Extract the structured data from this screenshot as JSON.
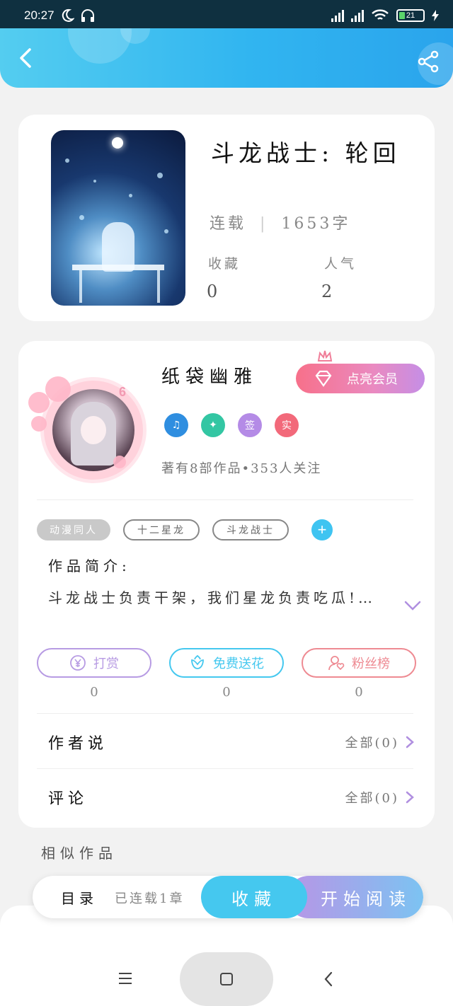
{
  "status_bar": {
    "time": "20:27",
    "battery": "21"
  },
  "book": {
    "title": "斗龙战士: 轮回",
    "status": "连载",
    "word_count": "1653字",
    "favorites_label": "收藏",
    "favorites_value": "0",
    "popularity_label": "人气",
    "popularity_value": "2"
  },
  "author": {
    "name": "纸袋幽雅",
    "level": "6",
    "vip_label": "点亮会员",
    "badges": [
      "签",
      "实"
    ],
    "stats": "著有8部作品•353人关注"
  },
  "tags": [
    "动漫同人",
    "十二星龙",
    "斗龙战士"
  ],
  "intro": {
    "label": "作品简介:",
    "text": "斗龙战士负责干架，我们星龙负责吃瓜!…"
  },
  "actions": [
    {
      "label": "打赏",
      "count": "0",
      "color": "#b79be3"
    },
    {
      "label": "免费送花",
      "count": "0",
      "color": "#45c8ef"
    },
    {
      "label": "粉丝榜",
      "count": "0",
      "color": "#ee8a92"
    }
  ],
  "rows": {
    "author_says": {
      "title": "作者说",
      "right": "全部(0)"
    },
    "comments": {
      "title": "评论",
      "right": "全部(0)"
    }
  },
  "similar_label": "相似作品",
  "bottom_bar": {
    "toc_label": "目录",
    "toc_count": "已连载1章",
    "collect_label": "收藏",
    "read_label": "开始阅读"
  }
}
